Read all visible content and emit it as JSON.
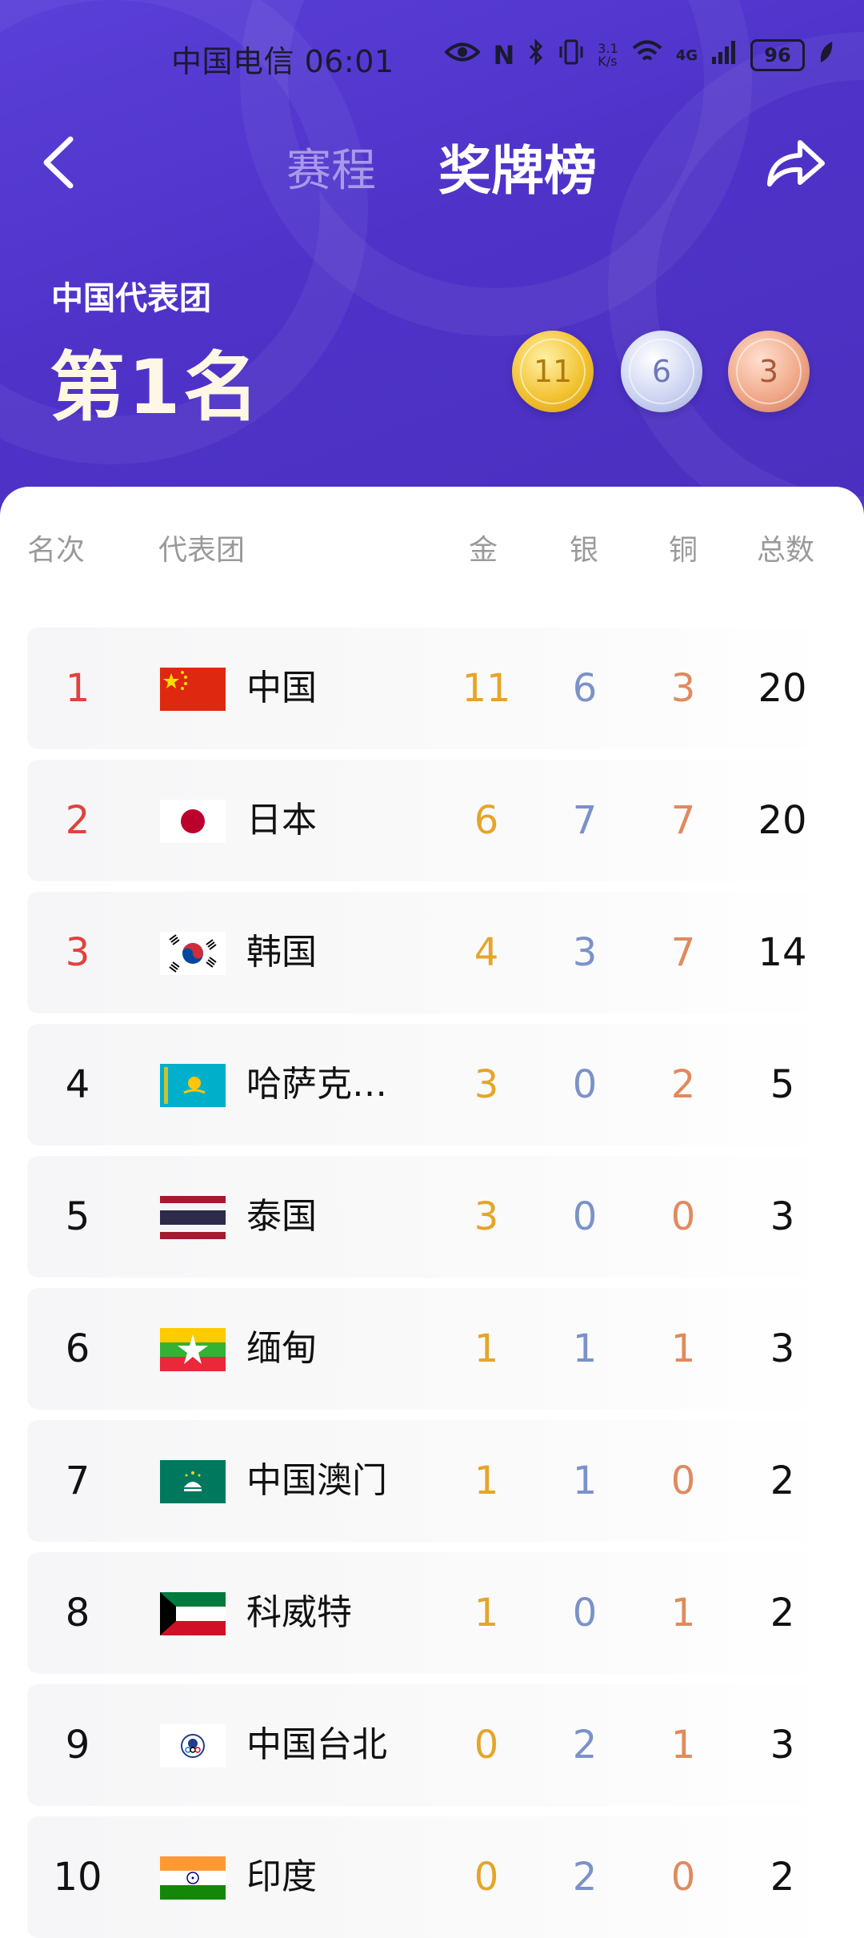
{
  "status_bar": {
    "carrier_time": "中国电信 06:01",
    "net_speed_top": "3.1",
    "net_speed_unit": "K/s",
    "network": "4G",
    "battery": "96",
    "icons": [
      "eye-icon",
      "nfc-icon",
      "bluetooth-icon",
      "vibrate-icon",
      "wifi-icon",
      "signal-icon",
      "battery-icon",
      "leaf-icon"
    ]
  },
  "nav": {
    "back_icon": "chevron-left-icon",
    "tab_schedule": "赛程",
    "tab_medals": "奖牌榜",
    "share_icon": "share-icon"
  },
  "summary": {
    "team_label": "中国代表团",
    "rank_text": "第1名",
    "gold": "11",
    "silver": "6",
    "bronze": "3"
  },
  "table": {
    "headers": {
      "rank": "名次",
      "team": "代表团",
      "gold": "金",
      "silver": "银",
      "bronze": "铜",
      "total": "总数"
    },
    "rows": [
      {
        "rank": "1",
        "flag": "cn",
        "name": "中国",
        "gold": "11",
        "silver": "6",
        "bronze": "3",
        "total": "20"
      },
      {
        "rank": "2",
        "flag": "jp",
        "name": "日本",
        "gold": "6",
        "silver": "7",
        "bronze": "7",
        "total": "20"
      },
      {
        "rank": "3",
        "flag": "kr",
        "name": "韩国",
        "gold": "4",
        "silver": "3",
        "bronze": "7",
        "total": "14"
      },
      {
        "rank": "4",
        "flag": "kz",
        "name": "哈萨克…",
        "gold": "3",
        "silver": "0",
        "bronze": "2",
        "total": "5"
      },
      {
        "rank": "5",
        "flag": "th",
        "name": "泰国",
        "gold": "3",
        "silver": "0",
        "bronze": "0",
        "total": "3"
      },
      {
        "rank": "6",
        "flag": "mm",
        "name": "缅甸",
        "gold": "1",
        "silver": "1",
        "bronze": "1",
        "total": "3"
      },
      {
        "rank": "7",
        "flag": "mo",
        "name": "中国澳门",
        "gold": "1",
        "silver": "1",
        "bronze": "0",
        "total": "2"
      },
      {
        "rank": "8",
        "flag": "kw",
        "name": "科威特",
        "gold": "1",
        "silver": "0",
        "bronze": "1",
        "total": "2"
      },
      {
        "rank": "9",
        "flag": "tpe",
        "name": "中国台北",
        "gold": "0",
        "silver": "2",
        "bronze": "1",
        "total": "3"
      },
      {
        "rank": "10",
        "flag": "in",
        "name": "印度",
        "gold": "0",
        "silver": "2",
        "bronze": "0",
        "total": "2"
      }
    ]
  },
  "colors": {
    "header_bg": "#4f33c9",
    "top_rank": "#e0423c",
    "gold": "#e5a52a",
    "silver": "#7b92c9",
    "bronze": "#e08a5e"
  }
}
